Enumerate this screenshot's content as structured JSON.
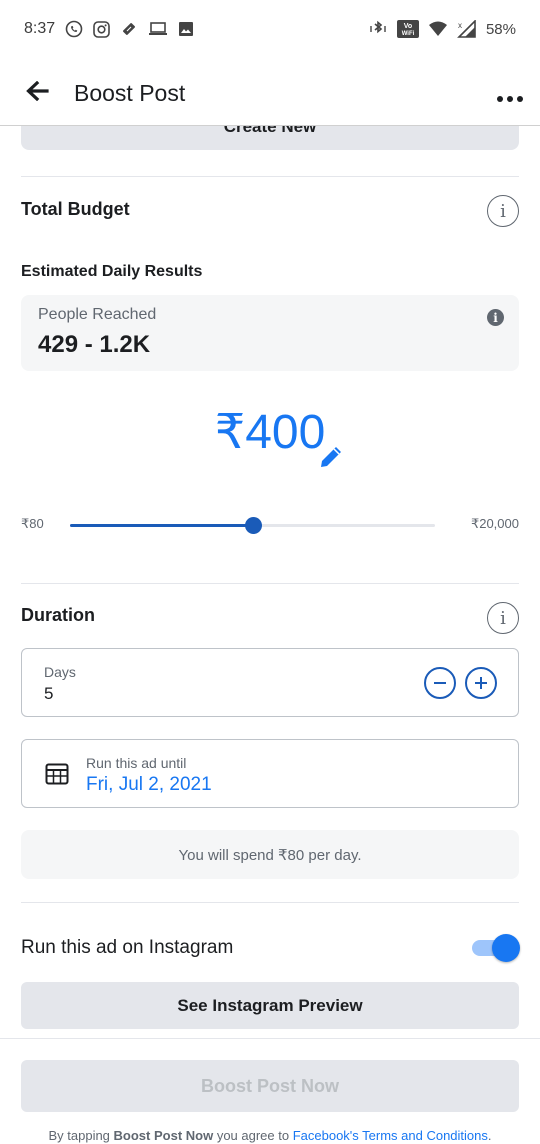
{
  "status_bar": {
    "time": "8:37",
    "wifi_badge": "Vo WiFi",
    "battery": "58%"
  },
  "app_bar": {
    "title": "Boost Post"
  },
  "create_new": {
    "label": "Create New"
  },
  "budget": {
    "title": "Total Budget",
    "estimated_title": "Estimated Daily Results",
    "reach_label": "People Reached",
    "reach_value": "429 - 1.2K",
    "amount": "₹400",
    "slider_min": "₹80",
    "slider_max": "₹20,000",
    "slider_fraction": 0.5
  },
  "duration": {
    "title": "Duration",
    "days_label": "Days",
    "days_value": "5",
    "run_until_label": "Run this ad until",
    "run_until_value": "Fri, Jul 2, 2021",
    "spend_note": "You will spend ₹80 per day."
  },
  "instagram": {
    "label": "Run this ad on Instagram",
    "enabled": true,
    "preview_button": "See Instagram Preview"
  },
  "footer": {
    "boost_button": "Boost Post Now",
    "terms_prefix": "By tapping ",
    "terms_bold": "Boost Post Now",
    "terms_middle": " you agree to ",
    "terms_link": "Facebook's Terms and Conditions",
    "terms_suffix": "."
  },
  "colors": {
    "accent": "#1877f2",
    "slider": "#1a5bb8"
  },
  "icons": [
    "whatsapp-icon",
    "instagram-icon",
    "ticket-icon",
    "laptop-icon",
    "image-icon",
    "bluetooth-vibrate-icon",
    "wifi-icon",
    "signal-icon",
    "back-arrow-icon",
    "more-icon",
    "info-icon",
    "pencil-icon",
    "minus-icon",
    "plus-icon",
    "calendar-icon"
  ]
}
